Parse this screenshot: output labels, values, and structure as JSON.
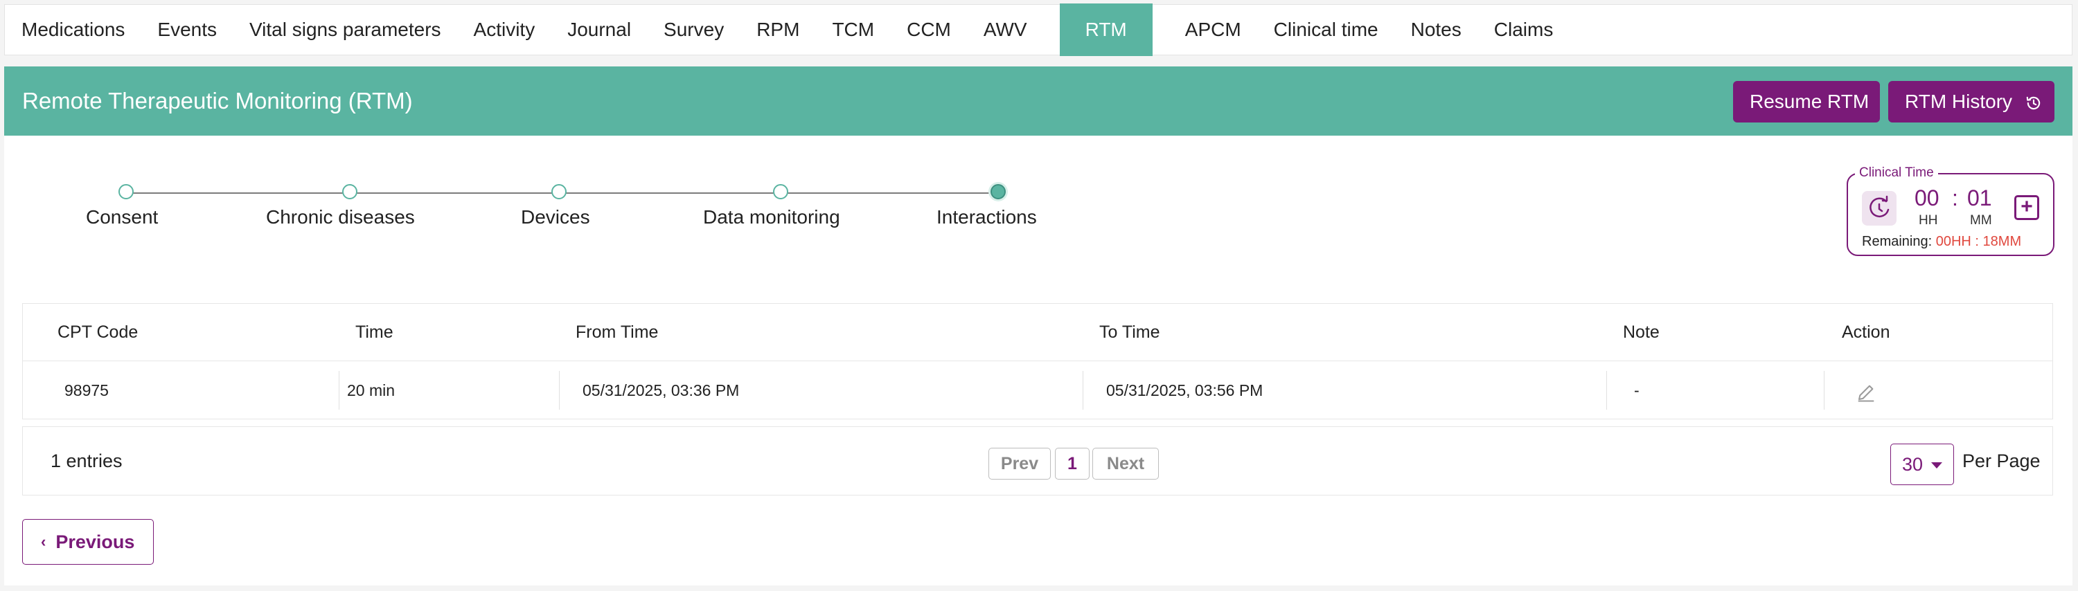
{
  "tabs": [
    {
      "label": "Medications",
      "active": false
    },
    {
      "label": "Events",
      "active": false
    },
    {
      "label": "Vital signs parameters",
      "active": false
    },
    {
      "label": "Activity",
      "active": false
    },
    {
      "label": "Journal",
      "active": false
    },
    {
      "label": "Survey",
      "active": false
    },
    {
      "label": "RPM",
      "active": false
    },
    {
      "label": "TCM",
      "active": false
    },
    {
      "label": "CCM",
      "active": false
    },
    {
      "label": "AWV",
      "active": false
    },
    {
      "label": "RTM",
      "active": true
    },
    {
      "label": "APCM",
      "active": false
    },
    {
      "label": "Clinical time",
      "active": false
    },
    {
      "label": "Notes",
      "active": false
    },
    {
      "label": "Claims",
      "active": false
    }
  ],
  "header": {
    "title": "Remote Therapeutic Monitoring (RTM)",
    "resume_label": "Resume RTM",
    "history_label": "RTM History",
    "history_icon": "history-icon"
  },
  "stepper": {
    "steps": [
      {
        "label": "Consent",
        "completed": false
      },
      {
        "label": "Chronic diseases",
        "completed": false
      },
      {
        "label": "Devices",
        "completed": false
      },
      {
        "label": "Data monitoring",
        "completed": false
      },
      {
        "label": "Interactions",
        "completed": true
      }
    ],
    "current": "Interactions"
  },
  "clinical_time": {
    "legend": "Clinical Time",
    "hours": "00",
    "minutes": "01",
    "hours_label": "HH",
    "minutes_label": "MM",
    "remaining_label": "Remaining:",
    "remaining_value": "00HH : 18MM",
    "sync_icon": "timer-sync-icon",
    "add_icon": "plus-square-icon"
  },
  "table": {
    "columns": [
      "CPT Code",
      "Time",
      "From Time",
      "To Time",
      "Note",
      "Action"
    ],
    "rows": [
      {
        "cpt": "98975",
        "time": "20 min",
        "from": "05/31/2025, 03:36 PM",
        "to": "05/31/2025, 03:56 PM",
        "note": "-",
        "action_icon": "edit-icon"
      }
    ]
  },
  "pagination": {
    "entries": "1 entries",
    "prev_label": "Prev",
    "current_page": "1",
    "next_label": "Next",
    "per_page": "30",
    "per_page_label": "Per Page"
  },
  "footer": {
    "previous_label": "Previous"
  },
  "colors": {
    "teal": "#5ab4a1",
    "purple": "#7a1a78",
    "remaining_red": "#e0483e"
  }
}
